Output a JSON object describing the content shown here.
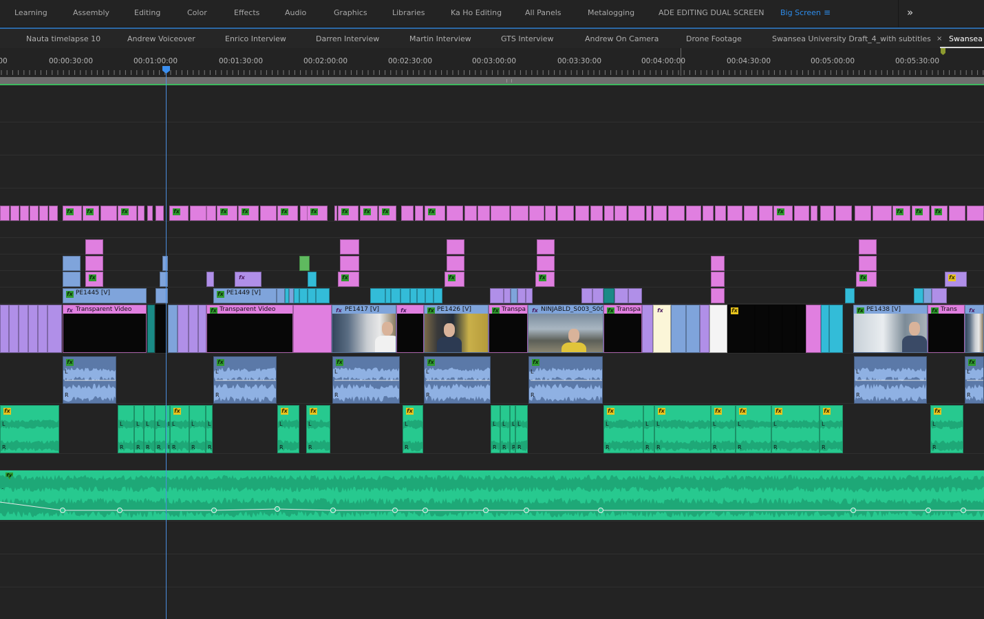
{
  "workspaces": {
    "tabs": [
      "Learning",
      "Assembly",
      "Editing",
      "Color",
      "Effects",
      "Audio",
      "Graphics",
      "Libraries",
      "Ka Ho Editing",
      "All Panels",
      "Metalogging",
      "ADE EDITING DUAL SCREEN",
      "Big Screen"
    ],
    "active": "Big Screen",
    "menu_icon": "≡",
    "overflow_icon": "»"
  },
  "sequences": {
    "tabs": [
      "Nauta timelapse 10",
      "Andrew Voiceover",
      "Enrico Interview",
      "Darren Interview",
      "Martin Interview",
      "GTS Interview",
      "Andrew On Camera",
      "Drone Footage",
      "Swansea University Draft_4_with subtitles",
      "Swansea U"
    ],
    "active": "Swansea U",
    "close_icon": "×"
  },
  "ruler": {
    "timecodes": [
      "00",
      "00:00:30:00",
      "00:01:00:00",
      "00:01:30:00",
      "00:02:00:00",
      "00:02:30:00",
      "00:03:00:00",
      "00:03:30:00",
      "00:04:00:00",
      "00:04:30:00",
      "00:05:00:00",
      "00:05:30:00"
    ]
  },
  "clips": {
    "pe1445": "PE1445 [V]",
    "pe1449": "PE1449 [V]",
    "pe1417": "PE1417 [V]",
    "pe1426": "PE1426 [V]",
    "pe1438": "PE1438 [V]",
    "transparent_video": "Transparent Video",
    "transparent_video_short": "Transpa",
    "transparent_video_short2": "Trans",
    "ninjabld": "NINJABLD_S003_S00",
    "channel_left": "L",
    "channel_right": "R",
    "fx": "fx"
  },
  "colors": {
    "accent": "#2d8ceb",
    "title_pink": "#e07fe0",
    "video_blue": "#7fa4db",
    "video_cyan": "#33bcd8",
    "video_purple": "#b08fe8",
    "audio_blue": "#6b8fc7",
    "audio_green": "#27c98f",
    "playhead": "#3b8ff0"
  }
}
